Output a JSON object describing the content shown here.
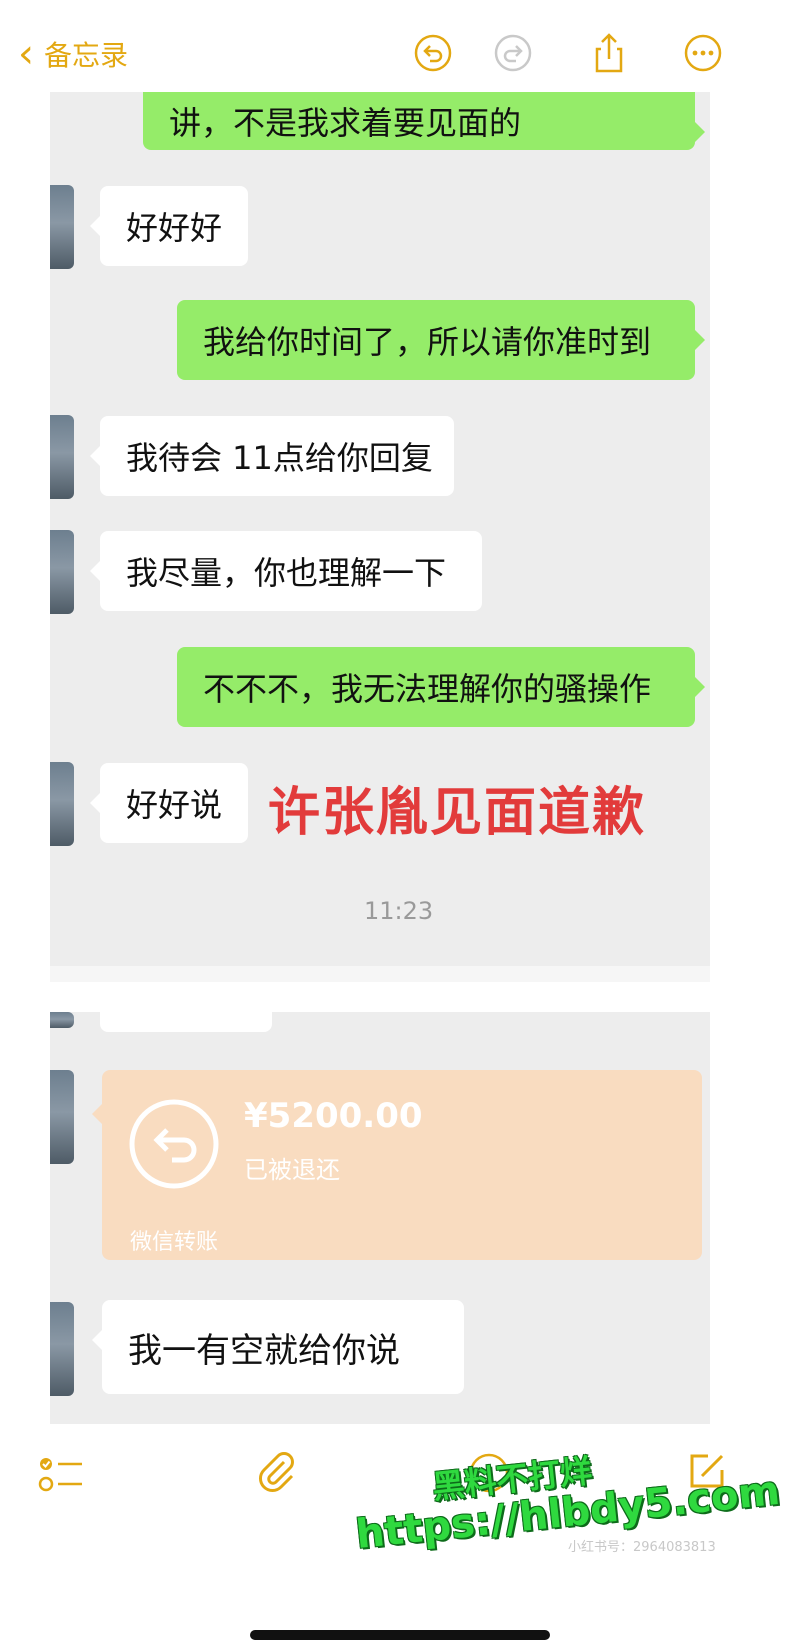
{
  "header": {
    "back_label": "备忘录",
    "accent_color": "#e3a812",
    "icons": [
      "undo-icon",
      "redo-icon",
      "share-icon",
      "more-icon"
    ]
  },
  "chat1": {
    "messages": [
      {
        "side": "out",
        "text": "讲，不是我求着要见面的"
      },
      {
        "side": "in",
        "text": "好好好"
      },
      {
        "side": "out",
        "text": "我给你时间了，所以请你准时到"
      },
      {
        "side": "in",
        "text": "我待会 11点给你回复"
      },
      {
        "side": "in",
        "text": "我尽量，你也理解一下"
      },
      {
        "side": "out",
        "text": "不不不，我无法理解你的骚操作"
      },
      {
        "side": "in",
        "text": "好好说"
      }
    ],
    "overlay_text": "许张胤见面道歉",
    "timestamp": "11:23"
  },
  "chat2": {
    "transfer": {
      "amount": "¥5200.00",
      "status": "已被退还",
      "label": "微信转账"
    },
    "last_message": "我一有空就给你说"
  },
  "toolbar": {
    "icons": [
      "checklist-icon",
      "paperclip-icon",
      "pen-icon",
      "compose-icon"
    ]
  },
  "watermark": {
    "line1": "黑料不打烊",
    "line2": "https://hlbdy5.com",
    "corner_text": "小红书号：2964083813"
  }
}
